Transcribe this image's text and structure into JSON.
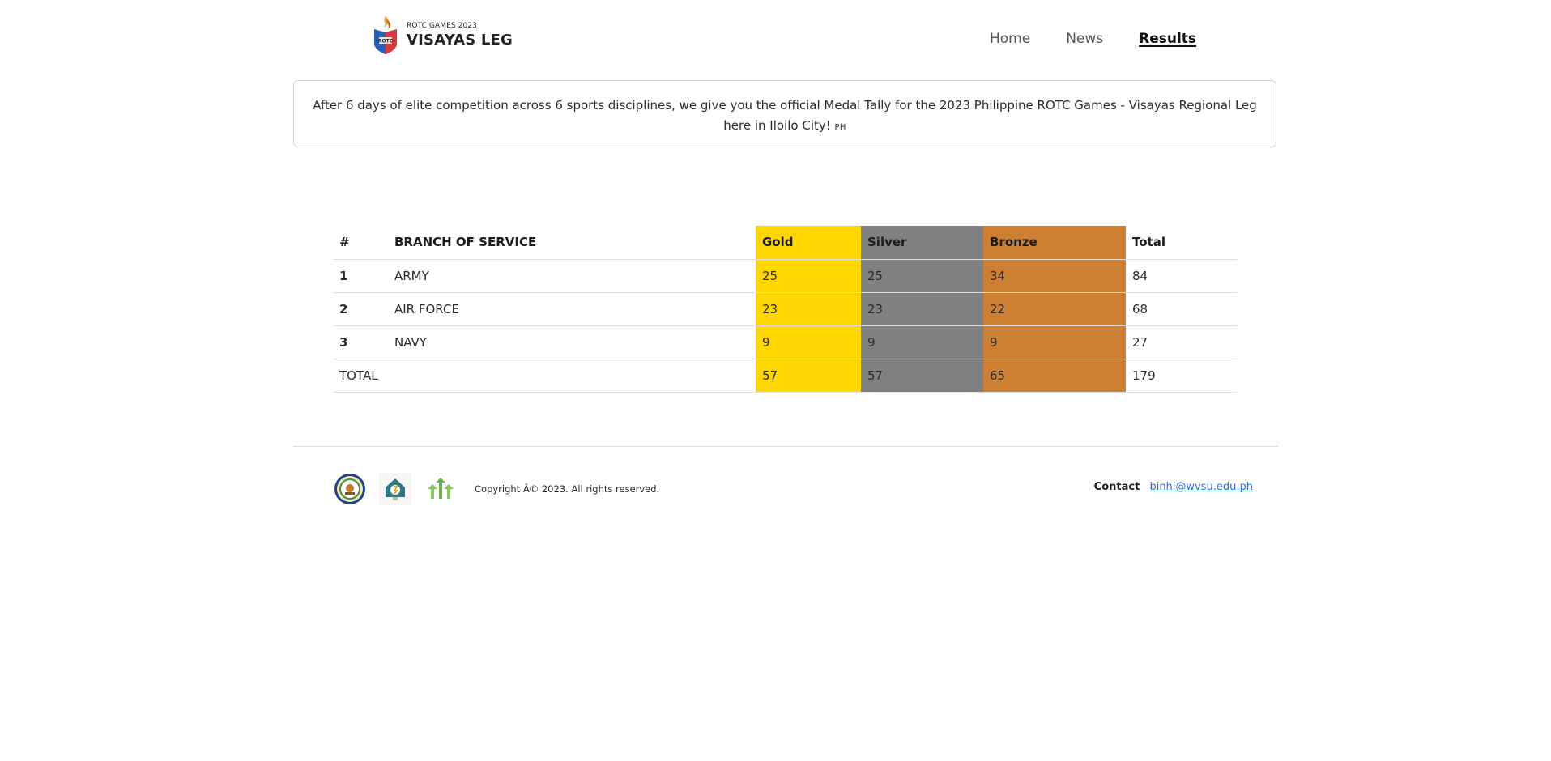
{
  "header": {
    "brand_subtitle": "ROTC GAMES 2023",
    "brand_title": "VISAYAS LEG",
    "logo_icon": "rotc-games-shield-logo"
  },
  "nav": {
    "items": [
      {
        "label": "Home",
        "active": false
      },
      {
        "label": "News",
        "active": false
      },
      {
        "label": "Results",
        "active": true
      }
    ]
  },
  "notice": {
    "text": "After 6 days of elite competition across 6 sports disciplines, we give you the official Medal Tally for the 2023 Philippine ROTC Games - Visayas Regional Leg here in Iloilo City!",
    "flag": "PH"
  },
  "medal_table": {
    "headers": {
      "rank": "#",
      "branch": "BRANCH OF SERVICE",
      "gold": "Gold",
      "silver": "Silver",
      "bronze": "Bronze",
      "total": "Total"
    },
    "rows": [
      {
        "rank": "1",
        "branch": "ARMY",
        "gold": "25",
        "silver": "25",
        "bronze": "34",
        "total": "84"
      },
      {
        "rank": "2",
        "branch": "AIR FORCE",
        "gold": "23",
        "silver": "23",
        "bronze": "22",
        "total": "68"
      },
      {
        "rank": "3",
        "branch": "NAVY",
        "gold": "9",
        "silver": "9",
        "bronze": "9",
        "total": "27"
      }
    ],
    "totals": {
      "label": "TOTAL",
      "gold": "57",
      "silver": "57",
      "bronze": "65",
      "total": "179"
    },
    "colors": {
      "gold": "#ffd700",
      "silver": "#808080",
      "bronze": "#cd7f32"
    }
  },
  "footer": {
    "icons": [
      "university-seal-icon",
      "lightbulb-house-icon",
      "binhi-tree-icon"
    ],
    "copyright": "Copyright Â© 2023. All rights reserved.",
    "contact_label": "Contact",
    "contact_email": "binhi@wvsu.edu.ph"
  }
}
